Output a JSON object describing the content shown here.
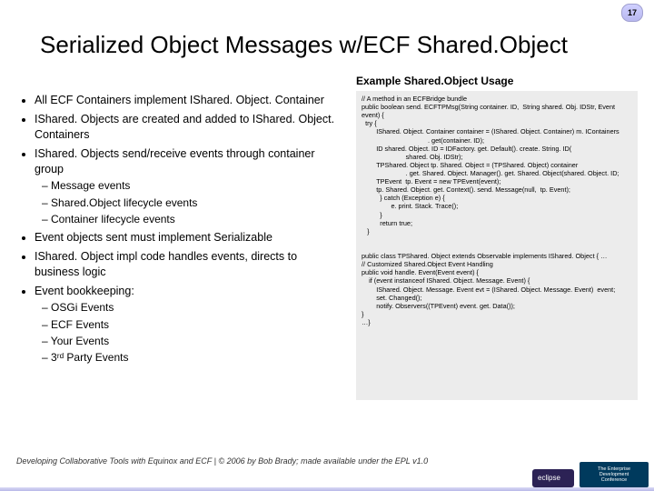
{
  "page_number": "17",
  "title": "Serialized Object Messages w/ECF Shared.Object",
  "subtitle": "Example Shared.Object Usage",
  "bullets": {
    "b0": "All ECF Containers implement IShared. Object. Container",
    "b1": "IShared. Objects are created and added to IShared. Object. Containers",
    "b2": "IShared. Objects send/receive events through container group",
    "b2a": "Message events",
    "b2b": "Shared.Object lifecycle events",
    "b2c": "Container lifecycle events",
    "b3": "Event objects sent must implement Serializable",
    "b4": "IShared. Object impl code handles events, directs to business logic",
    "b5": "Event bookkeeping:",
    "b5a": "OSGi Events",
    "b5b": "ECF Events",
    "b5c": "Your Events",
    "b5d": "3ʳᵈ Party Events"
  },
  "code": "// A method in an ECFBridge bundle\npublic boolean send. ECFTPMsg(String container. ID,  String shared. Obj. IDStr, Event event) {\n  try {\n        IShared. Object. Container container = (IShared. Object. Container) m. IContainers\n                                    . get(container. ID);\n        ID shared. Object. ID = IDFactory. get. Default(). create. String. ID(\n                        shared. Obj. IDStr);\n        TPShared. Object tp. Shared. Object = (TPShared. Object) container\n                        . get. Shared. Object. Manager(). get. Shared. Object(shared. Object. ID;\n        TPEvent  tp. Event = new TPEvent(event);\n        tp. Shared. Object. get. Context(). send. Message(null,  tp. Event);\n          } catch (Exception e) {\n                e. print. Stack. Trace();\n          }\n          return true;\n   }\n\n\npublic class TPShared. Object extends Observable implements IShared. Object { …\n// Customized Shared.Object Event Handling\npublic void handle. Event(Event event) {\n    if (event instanceof IShared. Object. Message. Event) {\n        IShared. Object. Message. Event evt = (IShared. Object. Message. Event)  event;\n        set. Changed();\n        notify. Observers((TPEvent) event. get. Data());\n}\n…}",
  "footer": "Developing Collaborative Tools with Equinox and ECF  |  © 2006 by Bob Brady; made available under the EPL v1.0",
  "logos": {
    "world_line1": "The Enterprise",
    "world_line2": "Development",
    "world_line3": "Conference"
  }
}
